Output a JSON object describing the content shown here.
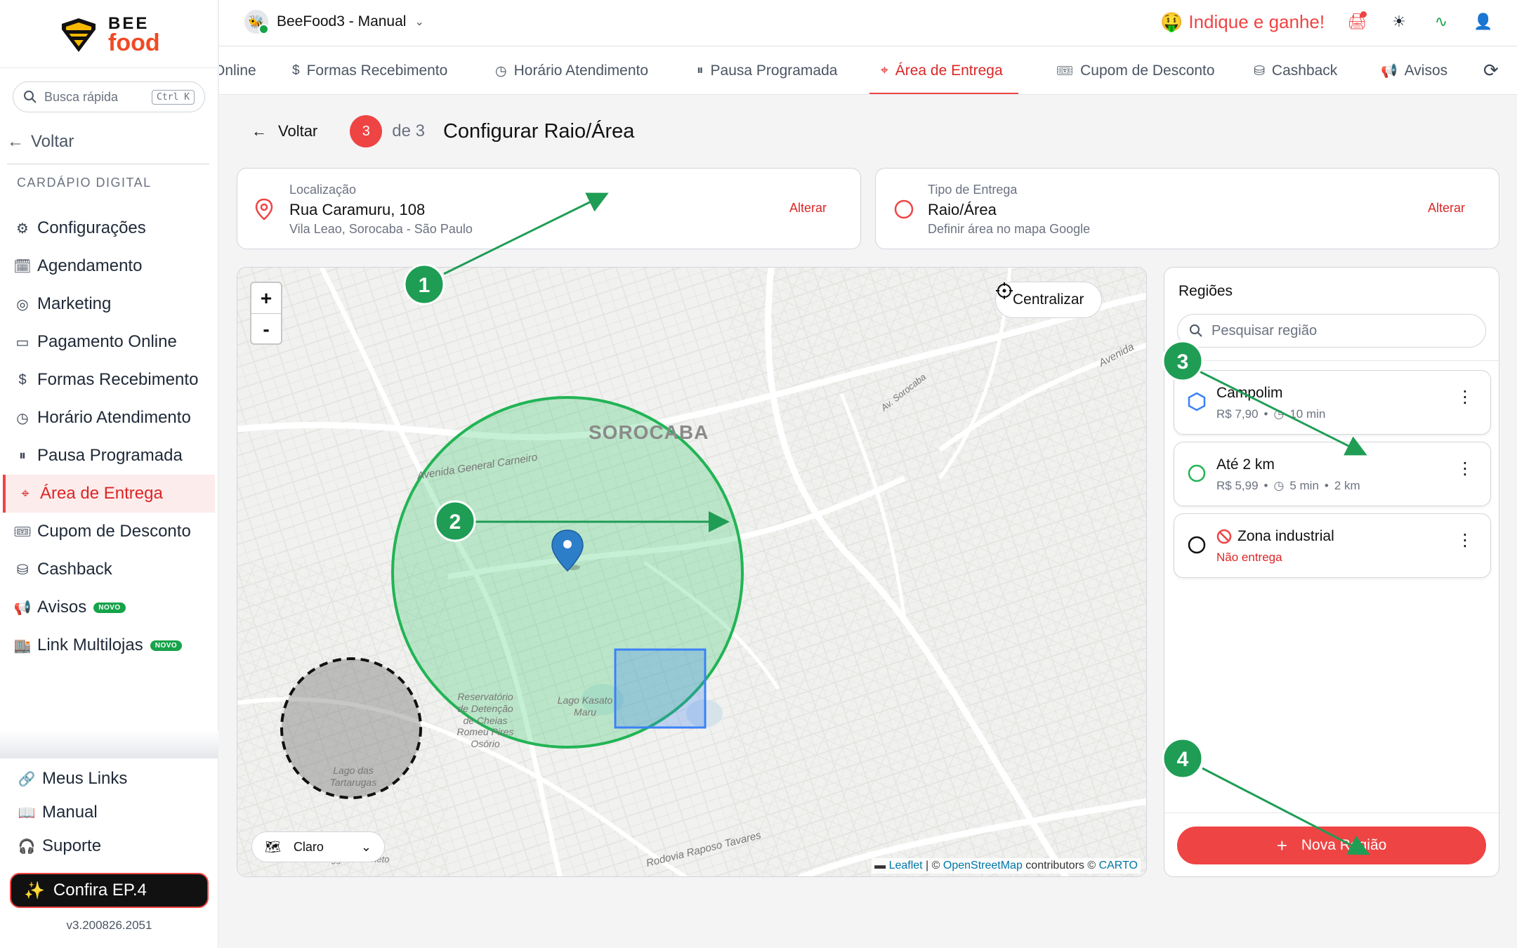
{
  "sidebar": {
    "logo_top": "BEE",
    "logo_bottom": "food",
    "search_placeholder": "Busca rápida",
    "search_shortcut": "Ctrl K",
    "back_label": "Voltar",
    "section_label": "CARDÁPIO DIGITAL",
    "items": [
      {
        "label": "Configurações",
        "icon": "gear-icon"
      },
      {
        "label": "Agendamento",
        "icon": "calendar-icon"
      },
      {
        "label": "Marketing",
        "icon": "target-icon"
      },
      {
        "label": "Pagamento Online",
        "icon": "card-icon"
      },
      {
        "label": "Formas Recebimento",
        "icon": "receipt-icon"
      },
      {
        "label": "Horário Atendimento",
        "icon": "clock-icon"
      },
      {
        "label": "Pausa Programada",
        "icon": "pause-icon"
      },
      {
        "label": "Área de Entrega",
        "icon": "pin-icon"
      },
      {
        "label": "Cupom de Desconto",
        "icon": "ticket-icon"
      },
      {
        "label": "Cashback",
        "icon": "coins-icon"
      },
      {
        "label": "Avisos",
        "icon": "megaphone-icon",
        "badge": "NOVO"
      },
      {
        "label": "Link Multilojas",
        "icon": "store-icon",
        "badge": "NOVO"
      }
    ],
    "bottom_items": [
      {
        "label": "Meus Links",
        "icon": "link-icon"
      },
      {
        "label": "Manual",
        "icon": "book-icon"
      },
      {
        "label": "Suporte",
        "icon": "headset-icon"
      }
    ],
    "confira_label": "Confira EP.4",
    "version": "v3.200826.2051"
  },
  "topbar": {
    "store_name": "BeeFood3 - Manual",
    "indique": "Indique e ganhe!"
  },
  "tabs": [
    {
      "label": "Online",
      "icon": "globe-icon"
    },
    {
      "label": "Formas Recebimento",
      "icon": "receipt-icon"
    },
    {
      "label": "Horário Atendimento",
      "icon": "clock-icon"
    },
    {
      "label": "Pausa Programada",
      "icon": "pause-icon"
    },
    {
      "label": "Área de Entrega",
      "icon": "pin-icon",
      "active": true
    },
    {
      "label": "Cupom de Desconto",
      "icon": "ticket-icon"
    },
    {
      "label": "Cashback",
      "icon": "coins-icon"
    },
    {
      "label": "Avisos",
      "icon": "megaphone-icon"
    }
  ],
  "step": {
    "back": "Voltar",
    "current": "3",
    "of": "de 3",
    "title": "Configurar Raio/Área"
  },
  "location_card": {
    "label": "Localização",
    "value": "Rua Caramuru, 108",
    "sub": "Vila Leao, Sorocaba - São Paulo",
    "action": "Alterar"
  },
  "delivery_card": {
    "label": "Tipo de Entrega",
    "value": "Raio/Área",
    "sub": "Definir área no mapa Google",
    "action": "Alterar"
  },
  "map": {
    "zoom_in": "+",
    "zoom_out": "-",
    "center_label": "Centralizar",
    "style_label": "Claro",
    "city_label": "SOROCABA",
    "labels": {
      "avenida_carneiro": "Avenida General Carneiro",
      "reservatorio": "Reservatório de Detenção de Cheias Romeu Pires Osório",
      "lago_kasato": "Lago Kasato Maru",
      "lago_tartarugas": "Lago das Tartarugas",
      "raposo": "Rodovia Raposo Tavares",
      "sorocaba_road": "Av. Sorocaba",
      "avenida_right": "Avenida",
      "veneto": "Villaggio di Veneto"
    },
    "attrib_leaflet": "Leaflet",
    "attrib_osm": "OpenStreetMap",
    "attrib_mid": "contributors ©",
    "attrib_carto": "CARTO"
  },
  "regions": {
    "title": "Regiões",
    "search_placeholder": "Pesquisar região",
    "items": [
      {
        "name": "Campolim",
        "price": "R$ 7,90",
        "time": "10 min",
        "distance": "",
        "shape": "polygon"
      },
      {
        "name": "Até 2 km",
        "price": "R$ 5,99",
        "time": "5 min",
        "distance": "2 km",
        "shape": "circle"
      },
      {
        "name": "Zona industrial",
        "status": "Não entrega",
        "shape": "blocked"
      }
    ],
    "new_button": "Nova Região"
  },
  "annotations": [
    "1",
    "2",
    "3",
    "4"
  ],
  "colors": {
    "accent": "#ef4444",
    "green": "#22b455",
    "blue": "#3b82f6",
    "annotation": "#1f9d55"
  }
}
